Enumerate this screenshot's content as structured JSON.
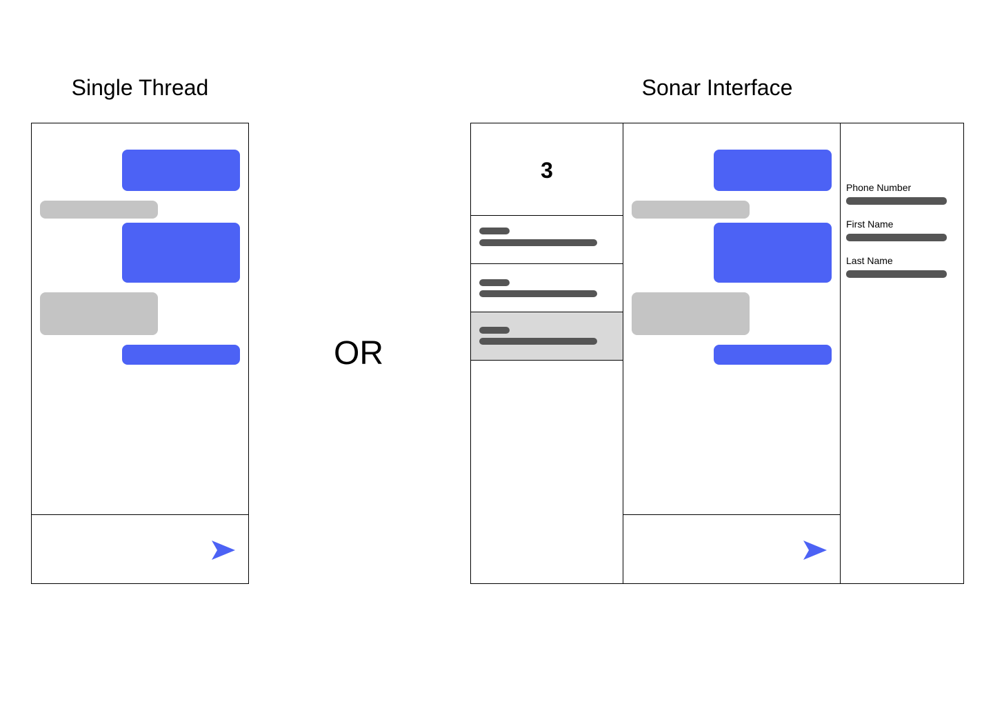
{
  "left": {
    "title": "Single Thread"
  },
  "divider": {
    "text": "OR"
  },
  "right": {
    "title": "Sonar Interface",
    "conversation_count": "3",
    "selected_conversation": 3,
    "fields": [
      {
        "label": "Phone Number"
      },
      {
        "label": "First Name"
      },
      {
        "label": "Last Name"
      }
    ]
  },
  "colors": {
    "sent_bubble": "#4c62f5",
    "received_bubble": "#c4c4c4",
    "placeholder_bar": "#555555",
    "selected_row": "#d9d9d9",
    "send_icon": "#4c62f5"
  },
  "icons": {
    "send": "send-arrow-icon"
  }
}
